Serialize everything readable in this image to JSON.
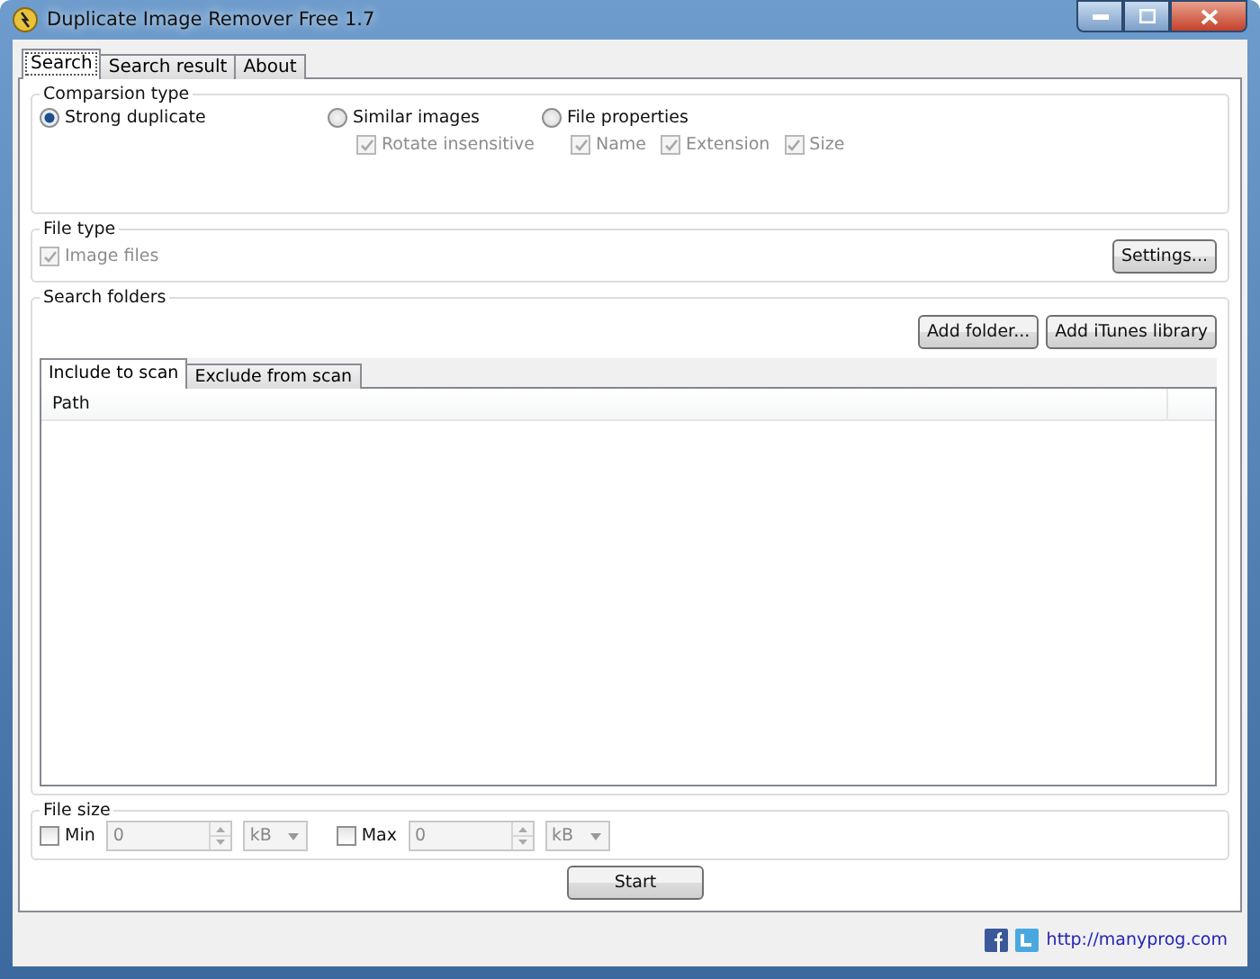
{
  "window": {
    "title": "Duplicate Image Remover Free 1.7"
  },
  "tabs": [
    {
      "label": "Search",
      "selected": true
    },
    {
      "label": "Search result",
      "selected": false
    },
    {
      "label": "About",
      "selected": false
    }
  ],
  "comparison": {
    "title": "Comparsion type",
    "options": [
      {
        "label": "Strong duplicate",
        "selected": true
      },
      {
        "label": "Similar images",
        "selected": false,
        "suboptions": [
          {
            "label": "Rotate insensitive",
            "checked": true,
            "disabled": true
          }
        ]
      },
      {
        "label": "File properties",
        "selected": false,
        "suboptions": [
          {
            "label": "Name",
            "checked": true,
            "disabled": true
          },
          {
            "label": "Extension",
            "checked": true,
            "disabled": true
          },
          {
            "label": "Size",
            "checked": true,
            "disabled": true
          }
        ]
      }
    ]
  },
  "file_type": {
    "title": "File type",
    "checkbox": {
      "label": "Image files",
      "checked": true,
      "disabled": true
    },
    "settings_button": "Settings..."
  },
  "search_folders": {
    "title": "Search folders",
    "buttons": [
      "Add folder...",
      "Add iTunes library"
    ],
    "tabs": [
      {
        "label": "Include to scan",
        "selected": true
      },
      {
        "label": "Exclude from scan",
        "selected": false
      }
    ],
    "columns": [
      "Path"
    ]
  },
  "file_size": {
    "title": "File size",
    "limits": [
      {
        "label": "Min",
        "checked": false,
        "value": "0",
        "unit": "kB"
      },
      {
        "label": "Max",
        "checked": false,
        "value": "0",
        "unit": "kB"
      }
    ]
  },
  "start_button": "Start",
  "footer": {
    "link": "http://manyprog.com"
  }
}
